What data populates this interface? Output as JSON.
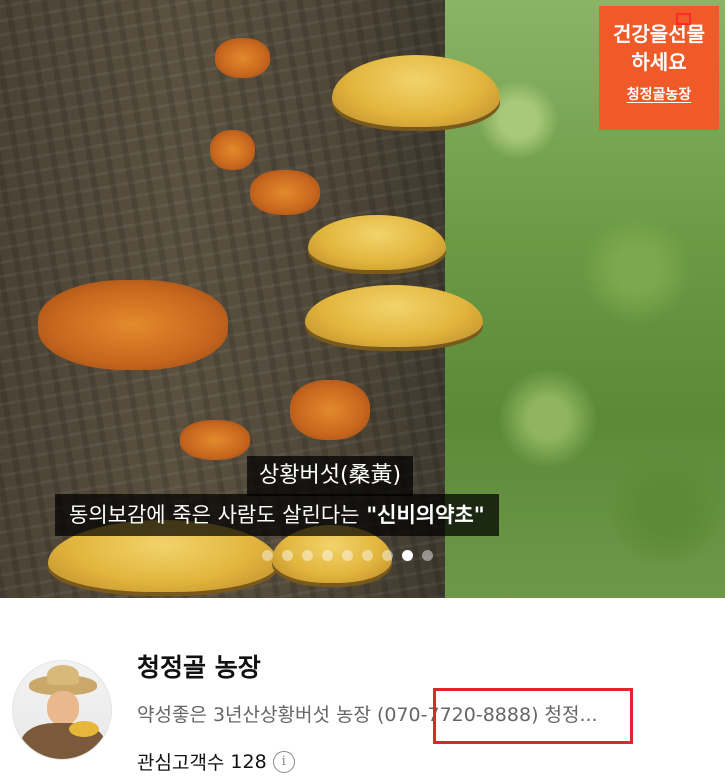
{
  "banner": {
    "promo": {
      "line1": "건강을선물",
      "line2": "하세요",
      "brand": "청정골농장"
    },
    "caption_title": "상황버섯(桑黃)",
    "caption_sub_prefix": "동의보감에 죽은 사람도 살린다는 ",
    "caption_sub_emphasis": "\"신비의약초\"",
    "carousel": {
      "total": 9,
      "active_index": 7
    }
  },
  "channel": {
    "name": "청정골 농장",
    "description": "약성좋은 3년산상황버섯 농장 (070-7720-8888) 청정...",
    "subscribers_label": "관심고객수",
    "subscribers_count": "128",
    "info_icon": "info-circle-icon"
  },
  "colors": {
    "promo_bg": "#f05a28",
    "highlight": "#e0262b"
  }
}
